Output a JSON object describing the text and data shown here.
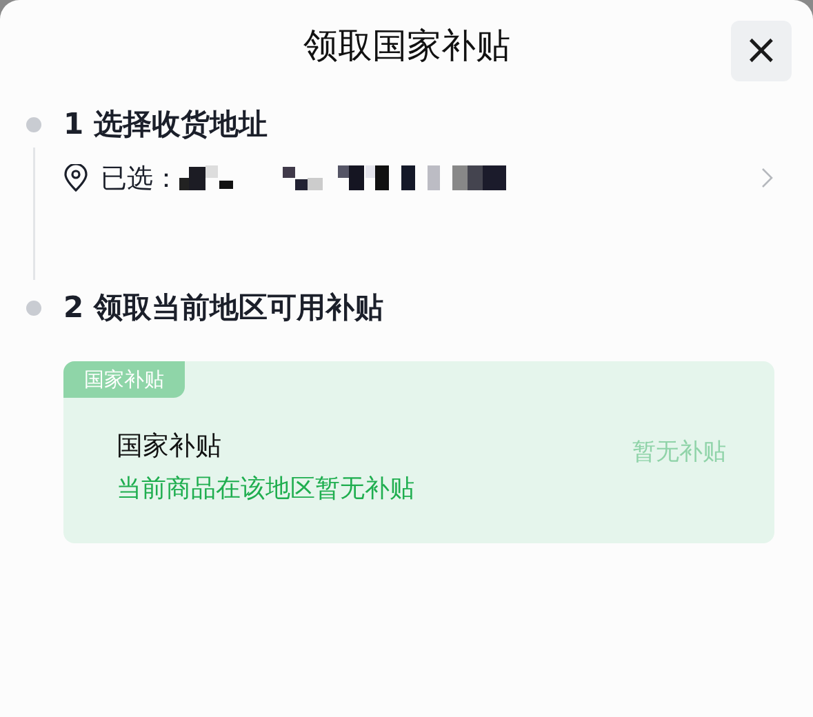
{
  "sheet": {
    "title": "领取国家补贴",
    "close": "×"
  },
  "steps": [
    {
      "label": "1 选择收货地址",
      "kind": "address",
      "address": {
        "prefix": "已选："
      }
    },
    {
      "label": "2 领取当前地区可用补贴",
      "kind": "subsidy",
      "card": {
        "tag": "国家补贴",
        "title": "国家补贴",
        "message": "当前商品在该地区暂无补贴",
        "status": "暂无补贴"
      }
    }
  ]
}
